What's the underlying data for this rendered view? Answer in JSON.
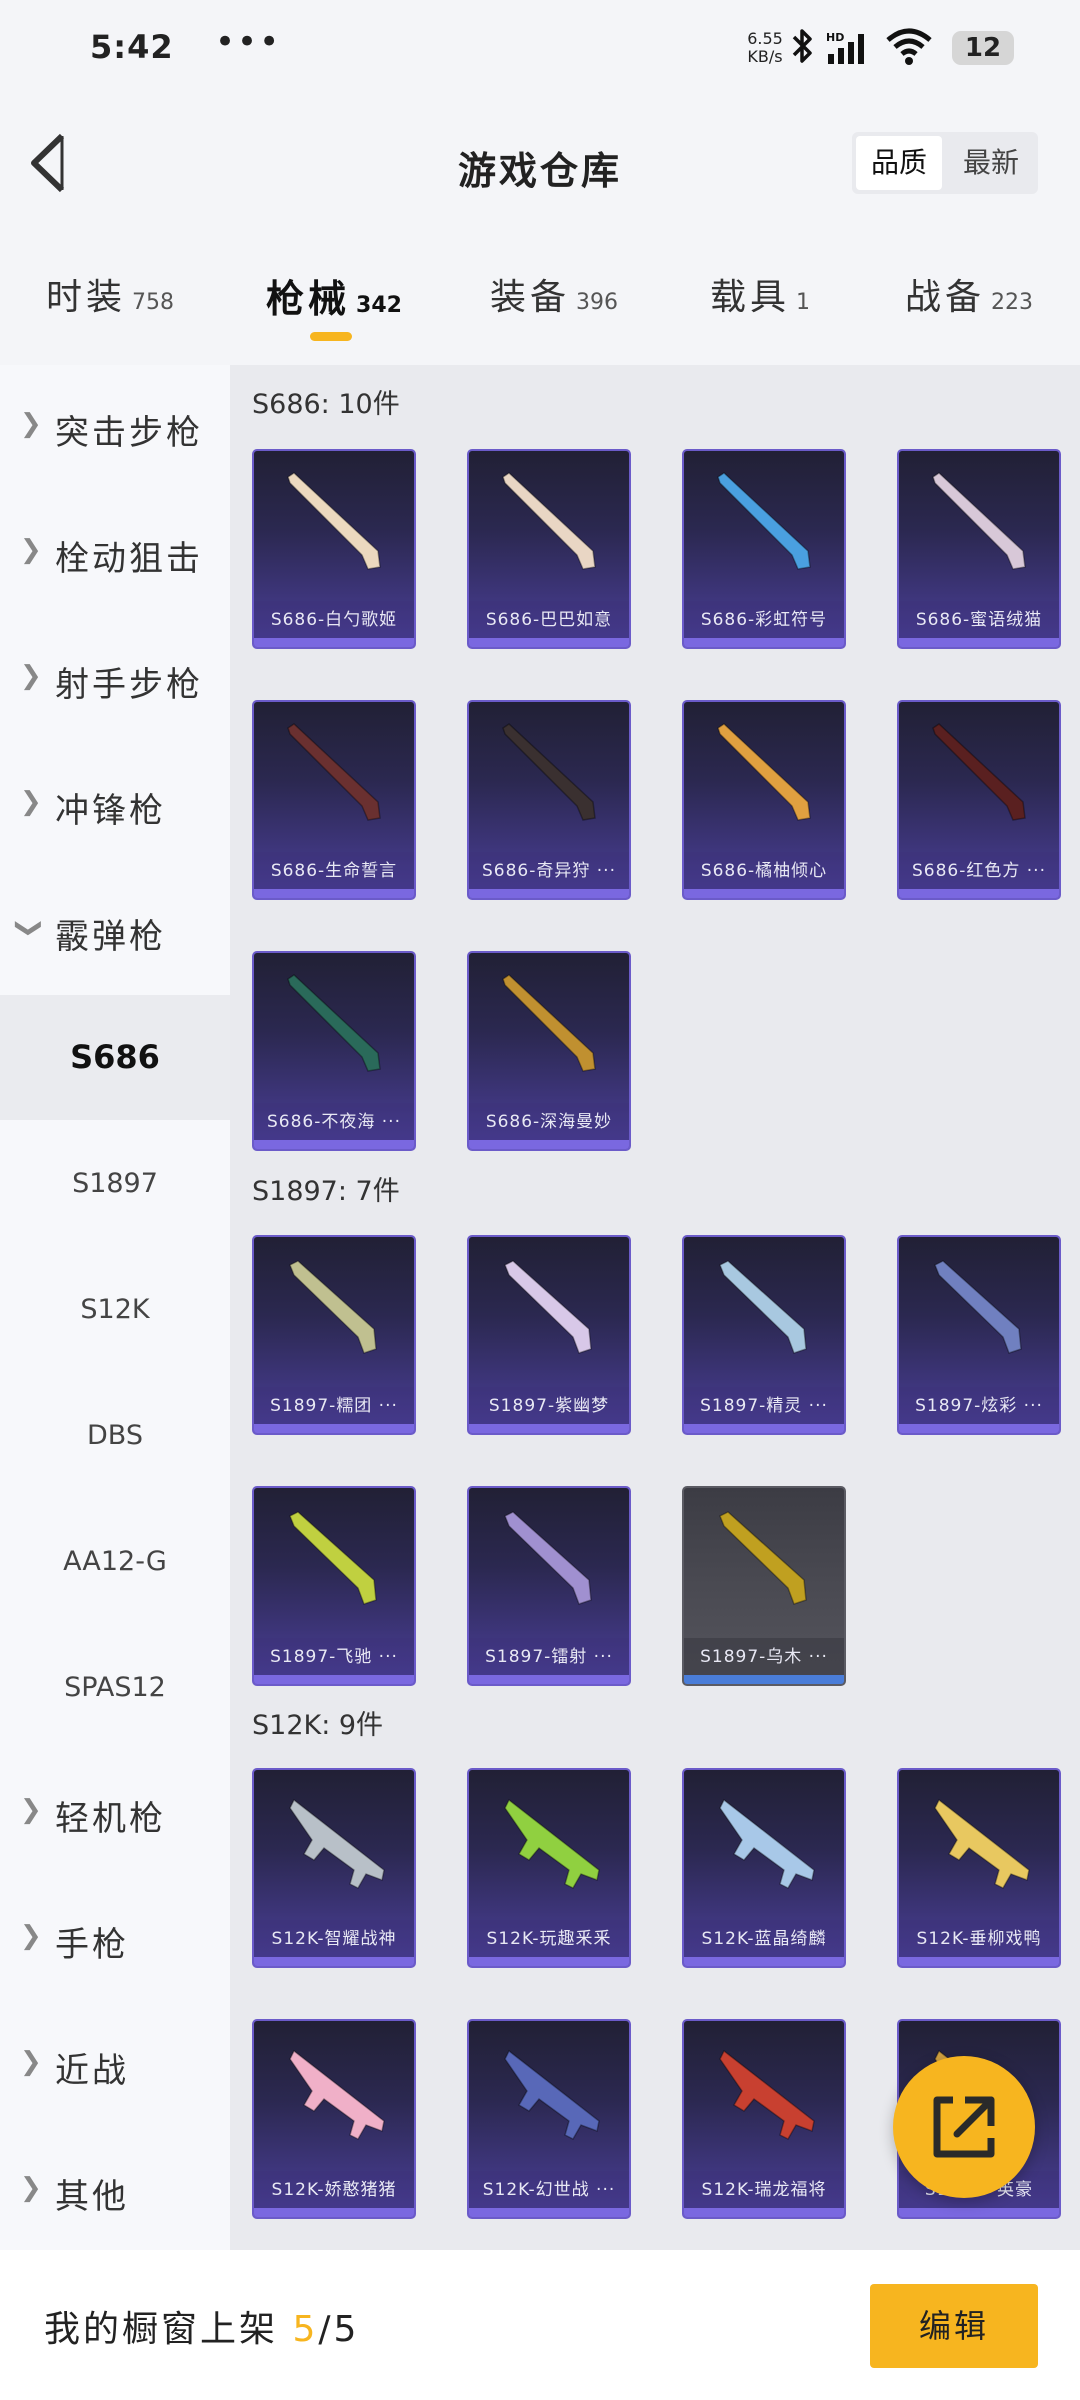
{
  "status_bar": {
    "time": "5:42",
    "more": "•••",
    "net_speed": "6.55 KB/s",
    "net_speed_value": "6.55",
    "net_speed_unit": "KB/s",
    "hd": "HD",
    "battery": "12"
  },
  "header": {
    "title": "游戏仓库",
    "sort_quality": "品质",
    "sort_latest": "最新"
  },
  "tabs": [
    {
      "label": "时装",
      "count": "758"
    },
    {
      "label": "枪械",
      "count": "342"
    },
    {
      "label": "装备",
      "count": "396"
    },
    {
      "label": "载具",
      "count": "1"
    },
    {
      "label": "战备",
      "count": "223"
    }
  ],
  "sidebar": {
    "items": [
      {
        "label": "突击步枪"
      },
      {
        "label": "栓动狙击"
      },
      {
        "label": "射手步枪"
      },
      {
        "label": "冲锋枪"
      },
      {
        "label": "霰弹枪"
      }
    ],
    "subitems": [
      "S686",
      "S1897",
      "S12K",
      "DBS",
      "AA12-G",
      "SPAS12"
    ],
    "items_after": [
      {
        "label": "轻机枪"
      },
      {
        "label": "手枪"
      },
      {
        "label": "近战"
      },
      {
        "label": "其他"
      }
    ]
  },
  "sections": [
    {
      "title": "S686: 10件",
      "items": [
        "S686-白勺歌姬",
        "S686-巴巴如意",
        "S686-彩虹符号",
        "S686-蜜语绒猫",
        "S686-生命誓言",
        "S686-奇异狩 ···",
        "S686-橘柚倾心",
        "S686-红色方 ···",
        "S686-不夜海 ···",
        "S686-深海曼妙"
      ]
    },
    {
      "title": "S1897: 7件",
      "items": [
        "S1897-糯团 ···",
        "S1897-紫幽梦",
        "S1897-精灵 ···",
        "S1897-炫彩 ···",
        "S1897-飞驰 ···",
        "S1897-镭射 ···",
        "S1897-乌木 ···"
      ]
    },
    {
      "title": "S12K: 9件",
      "items": [
        "S12K-智耀战神",
        "S12K-玩趣釆釆",
        "S12K-蓝晶绮麟",
        "S12K-垂柳戏鸭",
        "S12K-娇憨猪猪",
        "S12K-幻世战 ···",
        "S12K-瑞龙福将",
        "S12K-···英豪"
      ]
    }
  ],
  "footer": {
    "label": "我的橱窗上架",
    "count": "5",
    "total": "/5",
    "edit": "编辑"
  },
  "colors": {
    "accent": "#f7b51f",
    "card_top": "#212035",
    "card_bottom": "#4b3f9a",
    "card_border": "#6b5bc9"
  },
  "icons": {
    "back": "back-chevron-icon",
    "share": "share-export-icon",
    "wifi": "wifi-icon",
    "bluetooth": "bluetooth-icon",
    "signal": "signal-icon",
    "battery": "battery-icon"
  }
}
